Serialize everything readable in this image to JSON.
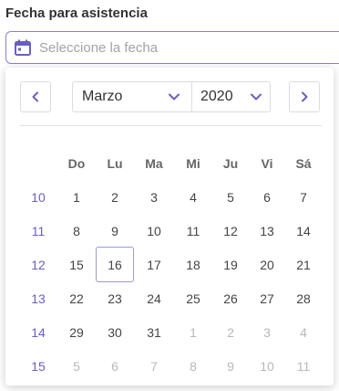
{
  "field": {
    "label": "Fecha para asistencia",
    "placeholder": "Seleccione la fecha",
    "value": ""
  },
  "calendar": {
    "month": "Marzo",
    "year": "2020",
    "weekdays": [
      "Do",
      "Lu",
      "Ma",
      "Mi",
      "Ju",
      "Vi",
      "Sá"
    ],
    "weeks": [
      {
        "week": "10",
        "days": [
          {
            "d": "1",
            "o": false
          },
          {
            "d": "2",
            "o": false
          },
          {
            "d": "3",
            "o": false
          },
          {
            "d": "4",
            "o": false
          },
          {
            "d": "5",
            "o": false
          },
          {
            "d": "6",
            "o": false
          },
          {
            "d": "7",
            "o": false
          }
        ]
      },
      {
        "week": "11",
        "days": [
          {
            "d": "8",
            "o": false
          },
          {
            "d": "9",
            "o": false
          },
          {
            "d": "10",
            "o": false
          },
          {
            "d": "11",
            "o": false
          },
          {
            "d": "12",
            "o": false
          },
          {
            "d": "13",
            "o": false
          },
          {
            "d": "14",
            "o": false
          }
        ]
      },
      {
        "week": "12",
        "days": [
          {
            "d": "15",
            "o": false
          },
          {
            "d": "16",
            "o": false,
            "today": true
          },
          {
            "d": "17",
            "o": false
          },
          {
            "d": "18",
            "o": false
          },
          {
            "d": "19",
            "o": false
          },
          {
            "d": "20",
            "o": false
          },
          {
            "d": "21",
            "o": false
          }
        ]
      },
      {
        "week": "13",
        "days": [
          {
            "d": "22",
            "o": false
          },
          {
            "d": "23",
            "o": false
          },
          {
            "d": "24",
            "o": false
          },
          {
            "d": "25",
            "o": false
          },
          {
            "d": "26",
            "o": false
          },
          {
            "d": "27",
            "o": false
          },
          {
            "d": "28",
            "o": false
          }
        ]
      },
      {
        "week": "14",
        "days": [
          {
            "d": "29",
            "o": false
          },
          {
            "d": "30",
            "o": false
          },
          {
            "d": "31",
            "o": false
          },
          {
            "d": "1",
            "o": true
          },
          {
            "d": "2",
            "o": true
          },
          {
            "d": "3",
            "o": true
          },
          {
            "d": "4",
            "o": true
          }
        ]
      },
      {
        "week": "15",
        "days": [
          {
            "d": "5",
            "o": true
          },
          {
            "d": "6",
            "o": true
          },
          {
            "d": "7",
            "o": true
          },
          {
            "d": "8",
            "o": true
          },
          {
            "d": "9",
            "o": true
          },
          {
            "d": "10",
            "o": true
          },
          {
            "d": "11",
            "o": true
          }
        ]
      }
    ]
  },
  "icons": {
    "calendar": "calendar-icon",
    "prev": "chevron-left-icon",
    "next": "chevron-right-icon",
    "dropdown": "chevron-down-icon"
  },
  "colors": {
    "accent": "#6a5fc1",
    "border_focus": "#8b7fd0",
    "muted": "#b8b8b8"
  }
}
